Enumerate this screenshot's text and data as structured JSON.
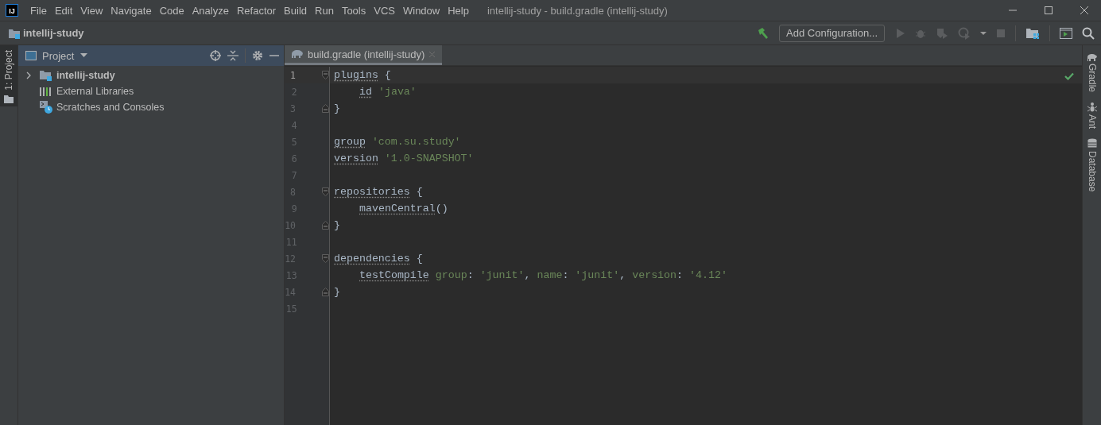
{
  "logo": "IJ",
  "menu": [
    "File",
    "Edit",
    "View",
    "Navigate",
    "Code",
    "Analyze",
    "Refactor",
    "Build",
    "Run",
    "Tools",
    "VCS",
    "Window",
    "Help"
  ],
  "window_title": "intellij-study - build.gradle (intellij-study)",
  "breadcrumb": "intellij-study",
  "toolbar": {
    "configuration": "Add Configuration..."
  },
  "left_strip": [
    {
      "label": "1: Project",
      "selected": true
    }
  ],
  "project_panel": {
    "title": "Project",
    "tree": [
      {
        "label": "intellij-study",
        "kind": "module",
        "expanded": false
      },
      {
        "label": "External Libraries",
        "kind": "libraries"
      },
      {
        "label": "Scratches and Consoles",
        "kind": "scratches"
      }
    ]
  },
  "tabs": [
    {
      "label": "build.gradle (intellij-study)",
      "selected": true
    }
  ],
  "editor": {
    "lines": [
      {
        "number": "1",
        "current": true,
        "fold_open": true,
        "tokens": [
          {
            "kind": "ident",
            "text": "plugins"
          },
          {
            "kind": "punct",
            "text": " {"
          }
        ]
      },
      {
        "number": "2",
        "current": false,
        "indented": true,
        "tokens": [
          {
            "kind": "ident",
            "text": "id"
          },
          {
            "kind": "string",
            "text": " 'java'"
          }
        ]
      },
      {
        "number": "3",
        "current": false,
        "fold_close": true,
        "tokens": [
          {
            "kind": "punct",
            "text": "}"
          }
        ]
      },
      {
        "number": "4",
        "current": false
      },
      {
        "number": "5",
        "current": false,
        "tokens": [
          {
            "kind": "ident",
            "text": "group"
          },
          {
            "kind": "string",
            "text": " 'com.su.study'"
          }
        ]
      },
      {
        "number": "6",
        "current": false,
        "tokens": [
          {
            "kind": "ident",
            "text": "version"
          },
          {
            "kind": "string",
            "text": " '1.0-SNAPSHOT'"
          }
        ]
      },
      {
        "number": "7",
        "current": false
      },
      {
        "number": "8",
        "current": false,
        "fold_open": true,
        "tokens": [
          {
            "kind": "ident",
            "text": "repositories"
          },
          {
            "kind": "punct",
            "text": " {"
          }
        ]
      },
      {
        "number": "9",
        "current": false,
        "indented": true,
        "tokens": [
          {
            "kind": "ident",
            "text": "mavenCentral"
          },
          {
            "kind": "punct",
            "text": "()"
          }
        ]
      },
      {
        "number": "10",
        "current": false,
        "fold_close": true,
        "tokens": [
          {
            "kind": "punct",
            "text": "}"
          }
        ]
      },
      {
        "number": "11",
        "current": false
      },
      {
        "number": "12",
        "current": false,
        "fold_open": true,
        "tokens": [
          {
            "kind": "ident",
            "text": "dependencies"
          },
          {
            "kind": "punct",
            "text": " {"
          }
        ]
      },
      {
        "number": "13",
        "current": false,
        "indented": true,
        "tokens": [
          {
            "kind": "ident",
            "text": "testCompile"
          },
          {
            "kind": "named",
            "text": " group"
          },
          {
            "kind": "punct",
            "text": ": "
          },
          {
            "kind": "string",
            "text": "'junit'"
          },
          {
            "kind": "punct",
            "text": ", "
          },
          {
            "kind": "named",
            "text": "name"
          },
          {
            "kind": "punct",
            "text": ": "
          },
          {
            "kind": "string",
            "text": "'junit'"
          },
          {
            "kind": "punct",
            "text": ", "
          },
          {
            "kind": "named",
            "text": "version"
          },
          {
            "kind": "punct",
            "text": ": "
          },
          {
            "kind": "string",
            "text": "'4.12'"
          }
        ]
      },
      {
        "number": "14",
        "current": false,
        "fold_close": true,
        "tokens": [
          {
            "kind": "punct",
            "text": "}"
          }
        ]
      },
      {
        "number": "15",
        "current": false
      }
    ]
  },
  "right_strip": [
    {
      "label": "Gradle",
      "kind": "gradle"
    },
    {
      "label": "Ant",
      "kind": "ant"
    },
    {
      "label": "Database",
      "kind": "database"
    }
  ]
}
